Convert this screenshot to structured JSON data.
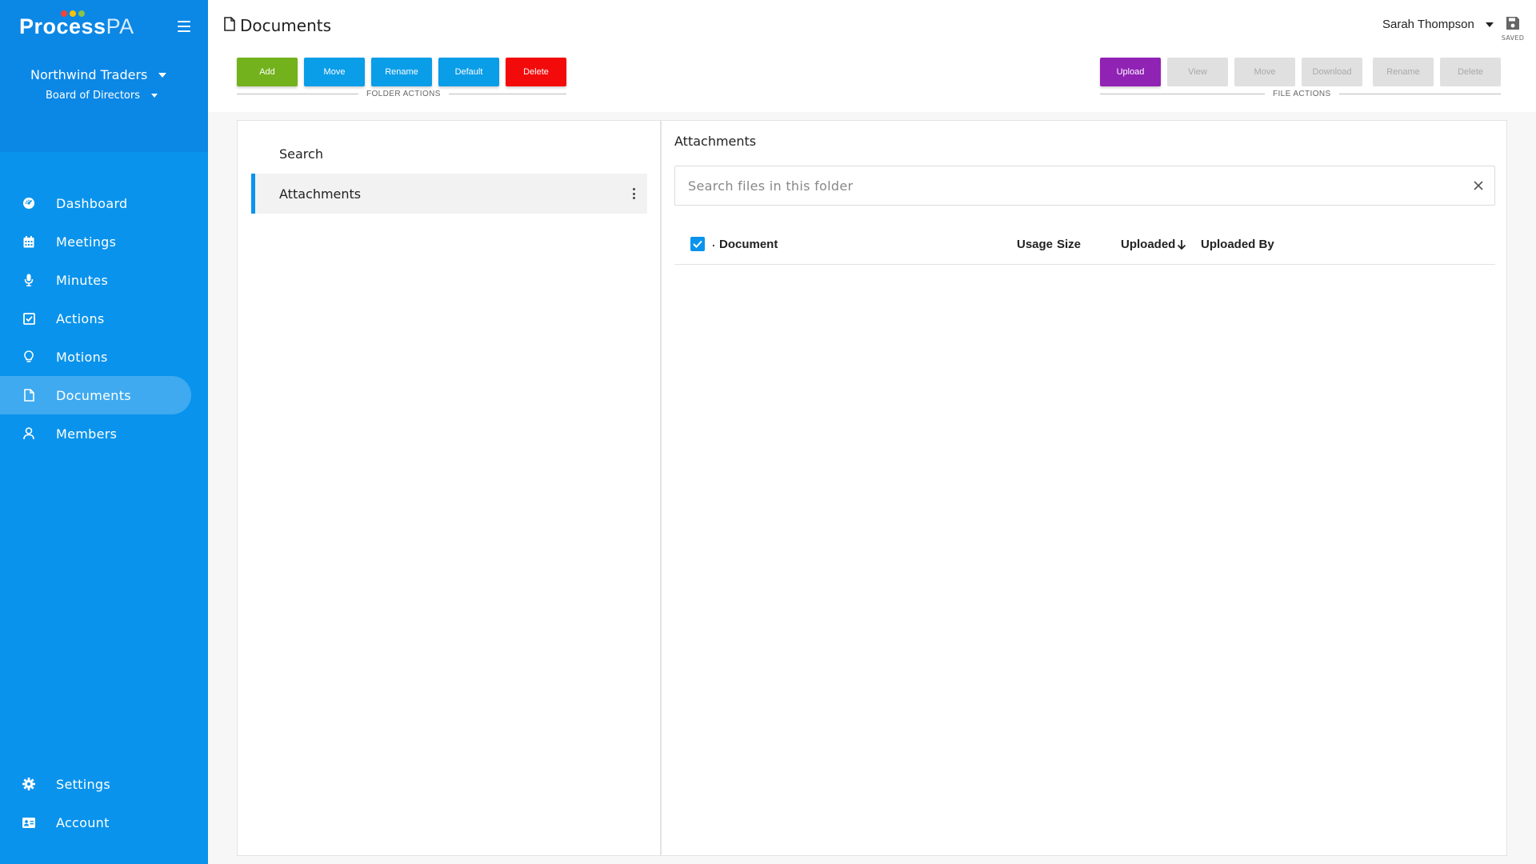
{
  "brand": {
    "logo_main": "Process",
    "logo_suffix": "PA",
    "dot_colors": [
      "#f44336",
      "#ffc107",
      "#8bc34a"
    ]
  },
  "org": {
    "name": "Northwind Traders",
    "board": "Board of Directors"
  },
  "nav": {
    "items": [
      {
        "label": "Dashboard",
        "icon": "dashboard-icon"
      },
      {
        "label": "Meetings",
        "icon": "calendar-icon"
      },
      {
        "label": "Minutes",
        "icon": "microphone-icon"
      },
      {
        "label": "Actions",
        "icon": "check-square-icon"
      },
      {
        "label": "Motions",
        "icon": "lightbulb-icon"
      },
      {
        "label": "Documents",
        "icon": "document-icon",
        "active": true
      },
      {
        "label": "Members",
        "icon": "user-icon"
      }
    ],
    "bottom": [
      {
        "label": "Settings",
        "icon": "gear-icon"
      },
      {
        "label": "Account",
        "icon": "id-card-icon"
      }
    ]
  },
  "header": {
    "title": "Documents",
    "user": "Sarah Thompson",
    "saved_label": "SAVED"
  },
  "folder_actions": {
    "group_label": "FOLDER ACTIONS",
    "add": "Add",
    "move": "Move",
    "rename": "Rename",
    "default": "Default",
    "delete": "Delete"
  },
  "file_actions": {
    "group_label": "FILE ACTIONS",
    "upload": "Upload",
    "view": "View",
    "move": "Move",
    "download": "Download",
    "rename": "Rename",
    "delete": "Delete"
  },
  "folders": {
    "search_label": "Search",
    "items": [
      {
        "label": "Attachments",
        "active": true
      }
    ]
  },
  "files": {
    "title": "Attachments",
    "search_placeholder": "Search files in this folder",
    "columns": {
      "sep": ".",
      "document": "Document",
      "usage": "Usage",
      "size": "Size",
      "uploaded": "Uploaded",
      "uploaded_by": "Uploaded By"
    },
    "rows": []
  },
  "colors": {
    "sidebar": "#0a93ec",
    "add": "#73b21c",
    "blue_action": "#0a9de8",
    "delete": "#f30a0a",
    "upload": "#9022b4"
  }
}
